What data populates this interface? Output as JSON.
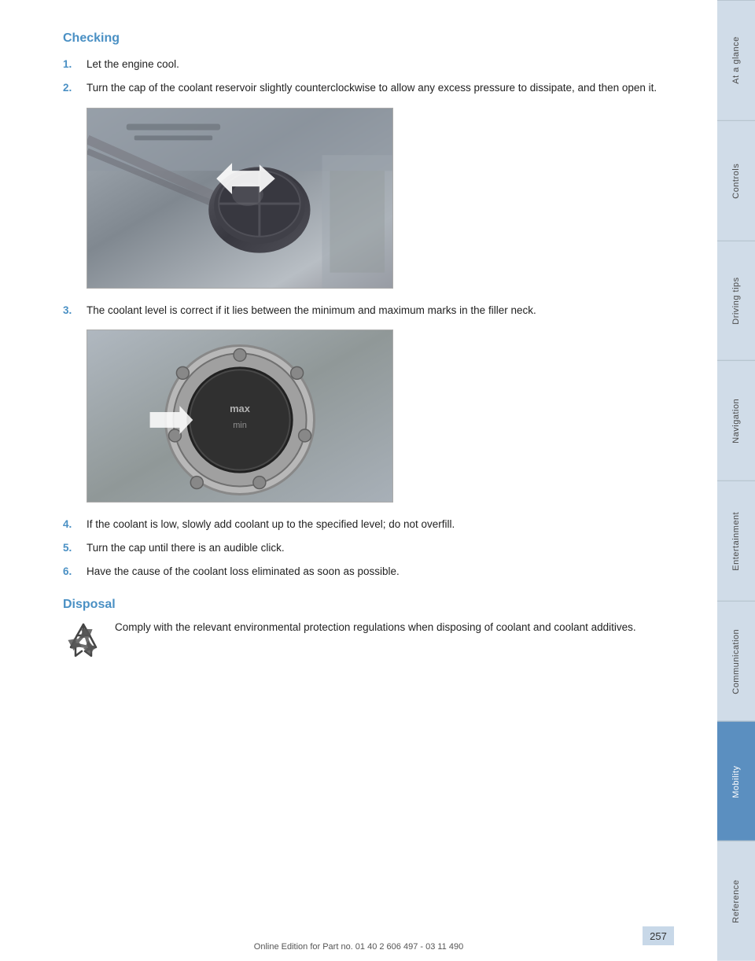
{
  "page": {
    "title": "Checking",
    "disposal_heading": "Disposal"
  },
  "steps": [
    {
      "number": "1.",
      "text": "Let the engine cool."
    },
    {
      "number": "2.",
      "text": "Turn the cap of the coolant reservoir slightly counterclockwise to allow any excess pressure to dissipate, and then open it."
    },
    {
      "number": "3.",
      "text": "The coolant level is correct if it lies between the minimum and maximum marks in the filler neck."
    },
    {
      "number": "4.",
      "text": "If the coolant is low, slowly add coolant up to the specified level; do not overfill."
    },
    {
      "number": "5.",
      "text": "Turn the cap until there is an audible click."
    },
    {
      "number": "6.",
      "text": "Have the cause of the coolant loss eliminated as soon as possible."
    }
  ],
  "disposal": {
    "text": "Comply with the relevant environmental protection regulations when disposing of coolant and coolant additives."
  },
  "sidebar": {
    "items": [
      {
        "label": "At a glance",
        "active": false
      },
      {
        "label": "Controls",
        "active": false
      },
      {
        "label": "Driving tips",
        "active": false
      },
      {
        "label": "Navigation",
        "active": false
      },
      {
        "label": "Entertainment",
        "active": false
      },
      {
        "label": "Communication",
        "active": false
      },
      {
        "label": "Mobility",
        "active": true
      },
      {
        "label": "Reference",
        "active": false
      }
    ]
  },
  "footer": {
    "text": "Online Edition for Part no. 01 40 2 606 497 - 03 11 490",
    "page_number": "257"
  }
}
